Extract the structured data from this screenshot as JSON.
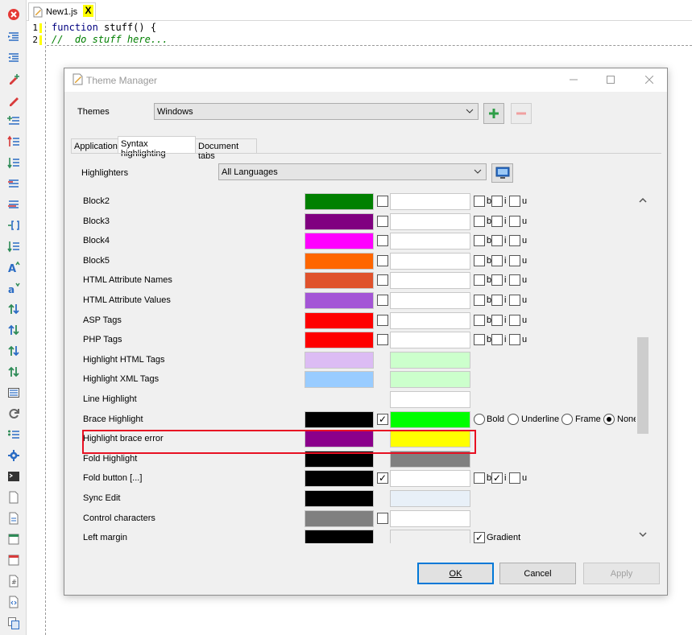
{
  "editor": {
    "tab_name": "New1.js",
    "tab_close": "X",
    "lines": [
      {
        "num": "1",
        "keyword": "function",
        "rest": " stuff() {"
      },
      {
        "num": "2",
        "comment": "//  do stuff here..."
      }
    ]
  },
  "dialog": {
    "title": "Theme Manager",
    "themes_label": "Themes",
    "theme_value": "Windows",
    "tabs": [
      "Application",
      "Syntax highlighting",
      "Document tabs"
    ],
    "highlighters_label": "Highlighters",
    "highlighters_value": "All Languages",
    "style_labels": {
      "b": "b",
      "i": "i",
      "u": "u"
    },
    "radio_labels": {
      "bold": "Bold",
      "underline": "Underline",
      "frame": "Frame",
      "none": "None"
    },
    "gradient_label": "Gradient",
    "buttons": {
      "ok": "OK",
      "cancel": "Cancel",
      "apply": "Apply"
    },
    "rows": [
      {
        "name": "Block2",
        "fg": "#008000",
        "bg": "#ffffff",
        "fg_cb": true,
        "styles": "biu"
      },
      {
        "name": "Block3",
        "fg": "#800080",
        "bg": "#ffffff",
        "fg_cb": true,
        "styles": "biu"
      },
      {
        "name": "Block4",
        "fg": "#ff00ff",
        "bg": "#ffffff",
        "fg_cb": true,
        "styles": "biu"
      },
      {
        "name": "Block5",
        "fg": "#ff6600",
        "bg": "#ffffff",
        "fg_cb": true,
        "styles": "biu"
      },
      {
        "name": "HTML Attribute Names",
        "fg": "#e0522c",
        "bg": "#ffffff",
        "fg_cb": true,
        "styles": "biu"
      },
      {
        "name": "HTML Attribute Values",
        "fg": "#a455d6",
        "bg": "#ffffff",
        "fg_cb": true,
        "styles": "biu"
      },
      {
        "name": "ASP Tags",
        "fg": "#ff0000",
        "bg": "#ffffff",
        "fg_cb": true,
        "styles": "biu"
      },
      {
        "name": "PHP Tags",
        "fg": "#ff0000",
        "bg": "#ffffff",
        "fg_cb": true,
        "styles": "biu"
      },
      {
        "name": "Highlight HTML Tags",
        "fg": "#dcbcf4",
        "bg": "#ccffcc"
      },
      {
        "name": "Highlight XML Tags",
        "fg": "#99ccff",
        "bg": "#ccffcc"
      },
      {
        "name": "Line Highlight",
        "fg": "",
        "bg": "#ffffff"
      },
      {
        "name": "Brace Highlight",
        "fg": "#000000",
        "bg": "#00ff00",
        "fg_cb": true,
        "fg_checked": true,
        "radios": true
      },
      {
        "name": "Highlight brace error",
        "fg": "#8b008b",
        "bg": "#ffff00"
      },
      {
        "name": "Fold Highlight",
        "fg": "#000000",
        "bg": "#808080"
      },
      {
        "name": "Fold button [...]",
        "fg": "#000000",
        "bg": "#ffffff",
        "fg_cb": true,
        "fg_checked": true,
        "styles": "biu",
        "i_checked": true
      },
      {
        "name": "Sync Edit",
        "fg": "#000000",
        "bg": "#e8f0f8"
      },
      {
        "name": "Control characters",
        "fg": "#808080",
        "bg": "#ffffff",
        "fg_cb": true
      },
      {
        "name": "Left margin",
        "fg": "#000000",
        "bg": "#f0f0f0",
        "gradient": true
      }
    ]
  }
}
